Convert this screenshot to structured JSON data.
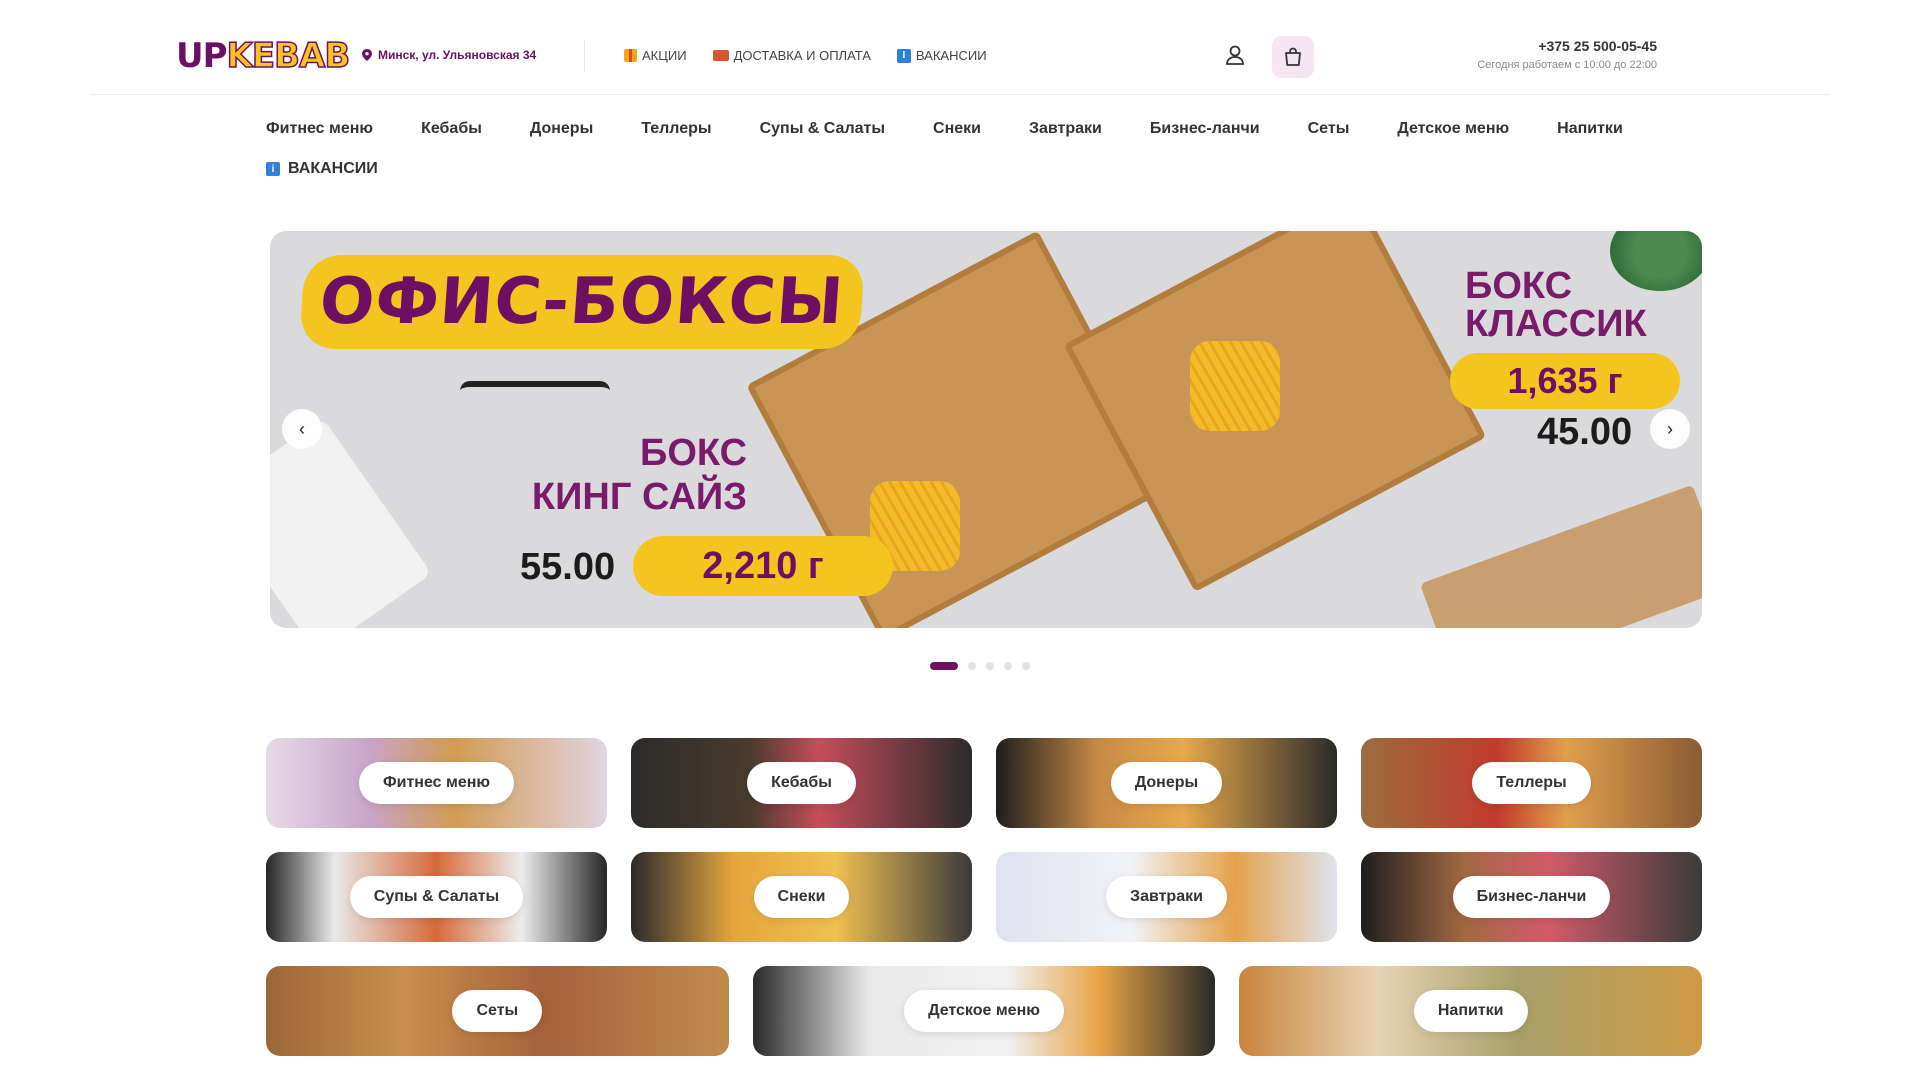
{
  "header": {
    "logo": {
      "part1": "UP",
      "part2": "KEBAB"
    },
    "address": "Минск, ул. Ульяновская 34",
    "links": [
      {
        "label": "АКЦИИ",
        "icon": "gift-icon"
      },
      {
        "label": "ДОСТАВКА И ОПЛАТА",
        "icon": "truck-icon"
      },
      {
        "label": "ВАКАНСИИ",
        "icon": "info-icon"
      }
    ],
    "phone": "+375 25 500-05-45",
    "hours": "Сегодня работаем с 10:00 до 22:00"
  },
  "category_nav": {
    "row1": [
      "Фитнес меню",
      "Кебабы",
      "Донеры",
      "Теллеры",
      "Супы & Салаты",
      "Снеки",
      "Завтраки",
      "Бизнес-ланчи",
      "Сеты",
      "Детское меню",
      "Напитки"
    ],
    "row2_label": "ВАКАНСИИ"
  },
  "banner": {
    "title": "ОФИС-БОКСЫ",
    "box1": {
      "name_line1": "БОКС",
      "name_line2": "КИНГ САЙЗ",
      "price": "55.00",
      "weight": "2,210 г"
    },
    "box2": {
      "name_line1": "БОКС",
      "name_line2": "КЛАССИК",
      "price": "45.00",
      "weight": "1,635 г"
    },
    "prev_arrow": "‹",
    "next_arrow": "›",
    "slide_count": 5,
    "active_slide": 1
  },
  "cards": {
    "row1": [
      "Фитнес меню",
      "Кебабы",
      "Донеры",
      "Теллеры"
    ],
    "row2": [
      "Супы & Салаты",
      "Снеки",
      "Завтраки",
      "Бизнес-ланчи"
    ],
    "row3": [
      "Сеты",
      "Детское меню",
      "Напитки"
    ]
  },
  "colors": {
    "brand_purple": "#6d0f63",
    "brand_yellow": "#f5c51f"
  }
}
